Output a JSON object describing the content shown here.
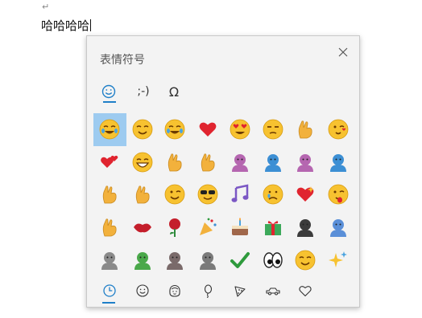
{
  "document": {
    "return_mark": "↵",
    "text": "哈哈哈哈"
  },
  "panel": {
    "title": "表情符号",
    "tabs": [
      {
        "id": "emoji",
        "label": "☺",
        "icon": "smiley-icon",
        "active": true
      },
      {
        "id": "kaomoji",
        "label": ";-)",
        "icon": "kaomoji-icon",
        "active": false
      },
      {
        "id": "symbols",
        "label": "Ω",
        "icon": "omega-icon",
        "active": false
      }
    ],
    "emojis": [
      {
        "name": "rolling-on-floor-laughing",
        "char": "🤣",
        "base": "#f7c230"
      },
      {
        "name": "smiling-face",
        "char": "😊",
        "base": "#f7c230"
      },
      {
        "name": "face-with-tears-of-joy",
        "char": "😂",
        "base": "#f7c230"
      },
      {
        "name": "red-heart",
        "char": "❤",
        "base": "#e0242f"
      },
      {
        "name": "heart-eyes",
        "char": "😍",
        "base": "#f7c230"
      },
      {
        "name": "unamused-face",
        "char": "😒",
        "base": "#f7c230"
      },
      {
        "name": "ok-hand",
        "char": "👌",
        "base": "#f2b13c"
      },
      {
        "name": "face-blowing-kiss",
        "char": "😘",
        "base": "#f7c230"
      },
      {
        "name": "two-hearts",
        "char": "💕",
        "base": "#e0242f"
      },
      {
        "name": "grinning-face",
        "char": "😁",
        "base": "#f7c230"
      },
      {
        "name": "thumbs-up",
        "char": "👍",
        "base": "#f2b13c"
      },
      {
        "name": "raising-hands",
        "char": "🙌",
        "base": "#f2b13c"
      },
      {
        "name": "person-facepalming",
        "char": "🤦",
        "base": "#b566b0"
      },
      {
        "name": "man-facepalming",
        "char": "🤦‍♂",
        "base": "#3c8fd4"
      },
      {
        "name": "woman-shrugging",
        "char": "🤷",
        "base": "#b566b0"
      },
      {
        "name": "man-shrugging",
        "char": "🤷‍♂",
        "base": "#3c8fd4"
      },
      {
        "name": "victory-hand",
        "char": "✌",
        "base": "#f2b13c"
      },
      {
        "name": "crossed-fingers",
        "char": "🤞",
        "base": "#f2b13c"
      },
      {
        "name": "winking-face",
        "char": "😉",
        "base": "#f7c230"
      },
      {
        "name": "smiling-face-with-sunglasses",
        "char": "😎",
        "base": "#f7c230"
      },
      {
        "name": "musical-notes",
        "char": "🎶",
        "base": "#7b57c4"
      },
      {
        "name": "crying-face",
        "char": "😢",
        "base": "#f7c230"
      },
      {
        "name": "sparkling-heart",
        "char": "💖",
        "base": "#e0242f"
      },
      {
        "name": "zany-face",
        "char": "😜",
        "base": "#f7c230"
      },
      {
        "name": "clapping-hands",
        "char": "👏",
        "base": "#f2b13c"
      },
      {
        "name": "kiss-mark",
        "char": "💋",
        "base": "#c41e2b"
      },
      {
        "name": "rose",
        "char": "🌹",
        "base": "#c41e2b"
      },
      {
        "name": "party-popper",
        "char": "🎉",
        "base": "#f2b13c"
      },
      {
        "name": "birthday-cake",
        "char": "🎂",
        "base": "#a0674a"
      },
      {
        "name": "wrapped-gift",
        "char": "🎁",
        "base": "#3ca95a"
      },
      {
        "name": "ninja-cat",
        "char": "🐱‍👤",
        "base": "#3b3b3b"
      },
      {
        "name": "astro-cat",
        "char": "🐱‍🚀",
        "base": "#5a8fd8"
      },
      {
        "name": "hacker-cat",
        "char": "🐱‍💻",
        "base": "#8a8a8a"
      },
      {
        "name": "dino-cat",
        "char": "🐱‍🐉",
        "base": "#4aa84a"
      },
      {
        "name": "stunt-cat",
        "char": "🐱‍🏍",
        "base": "#7a6a6a"
      },
      {
        "name": "hipster-cat",
        "char": "🐱‍👓",
        "base": "#7a7a7a"
      },
      {
        "name": "check-mark",
        "char": "✔",
        "base": "#2e9a3c"
      },
      {
        "name": "eyes",
        "char": "👀",
        "base": "#ffffff"
      },
      {
        "name": "slightly-smiling-face",
        "char": "🙂",
        "base": "#f7c230"
      },
      {
        "name": "sparkles",
        "char": "✨",
        "base": "#f7c230"
      }
    ],
    "categories": [
      {
        "name": "recent",
        "icon": "clock-icon",
        "active": true
      },
      {
        "name": "smileys",
        "icon": "smiley-face-icon",
        "active": false
      },
      {
        "name": "people",
        "icon": "person-face-icon",
        "active": false
      },
      {
        "name": "celebration",
        "icon": "balloon-icon",
        "active": false
      },
      {
        "name": "food",
        "icon": "pizza-icon",
        "active": false
      },
      {
        "name": "travel",
        "icon": "car-icon",
        "active": false
      },
      {
        "name": "symbols",
        "icon": "heart-outline-icon",
        "active": false
      }
    ]
  }
}
